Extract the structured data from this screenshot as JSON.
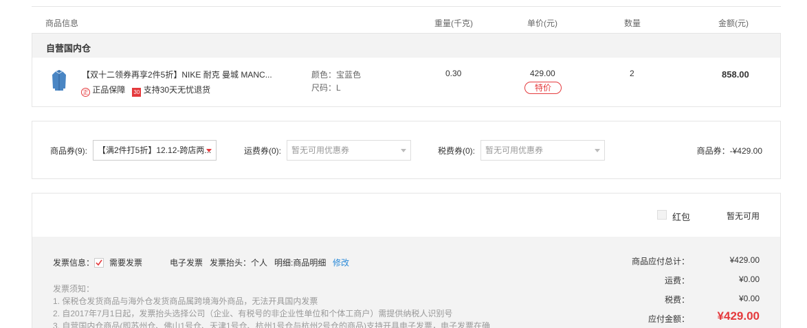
{
  "table_header": {
    "product_info": "商品信息",
    "weight": "重量(千克)",
    "unit_price": "单价(元)",
    "quantity": "数量",
    "amount": "金额(元)"
  },
  "warehouse": {
    "name": "自营国内仓"
  },
  "product": {
    "title": "【双十二领券再享2件5折】NIKE 耐克 曼城 MANC...",
    "badge_genuine_icon": "正",
    "badge_genuine": "正品保障",
    "badge_return_icon": "30",
    "badge_return": "支持30天无忧退货",
    "color": "颜色：宝蓝色",
    "size": "尺码：L",
    "weight": "0.30",
    "price": "429.00",
    "special_tag": "特价",
    "quantity": "2",
    "amount": "858.00"
  },
  "coupons": {
    "goods_label": "商品券(9):",
    "goods_value": "【满2件打5折】12.12-跨店两...",
    "shipping_label": "运费券(0):",
    "shipping_value": "暂无可用优惠券",
    "tax_label": "税费券(0):",
    "tax_value": "暂无可用优惠券",
    "goods_discount": "商品券：-¥429.00"
  },
  "red_packet": {
    "label": "红包",
    "status": "暂无可用"
  },
  "invoice": {
    "label": "发票信息：",
    "need_invoice": "需要发票",
    "type": "电子发票",
    "title": "发票抬头：个人",
    "detail": "明细:商品明细",
    "edit": "修改",
    "notice_title": "发票须知：",
    "notice_1": "1. 保税仓发货商品与海外仓发货商品属跨境海外商品，无法开具国内发票",
    "notice_2": "2. 自2017年7月1日起，发票抬头选择公司（企业、有税号的非企业性单位和个体工商户）需提供纳税人识别号",
    "notice_3": "3. 自营国内仓商品(即苏州仓、佛山1号仓、天津1号仓、杭州1号仓与杭州2号仓的商品)支持开具电子发票，电子发票在确"
  },
  "summary": {
    "goods_total_label": "商品应付总计：",
    "goods_total": "¥429.00",
    "shipping_label": "运费：",
    "shipping": "¥0.00",
    "tax_label": "税费：",
    "tax": "¥0.00",
    "payable_label": "应付金额：",
    "payable": "¥429.00"
  },
  "colors": {
    "accent_red": "#e4393c",
    "link_blue": "#2a8ad8"
  }
}
